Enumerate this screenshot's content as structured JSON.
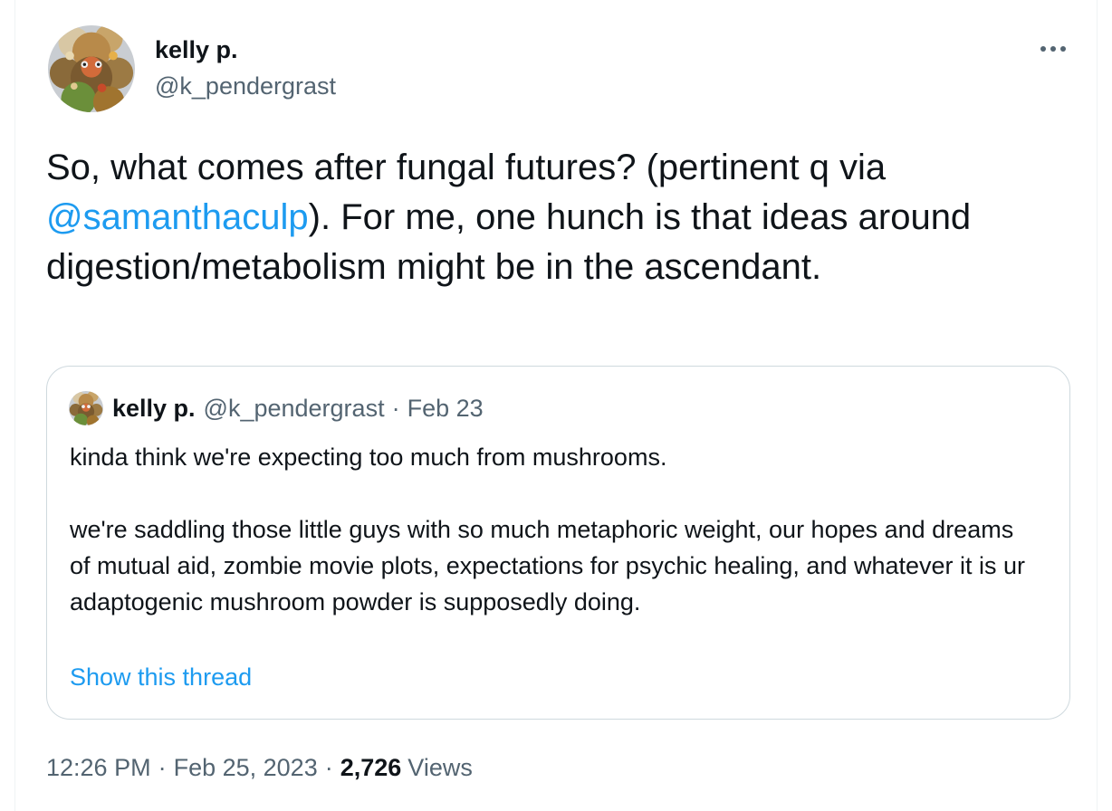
{
  "tweet": {
    "author": {
      "name": "kelly p.",
      "handle": "@k_pendergrast"
    },
    "more_icon": "more-horizontal-icon",
    "text": {
      "before_mention": "So, what comes after fungal futures? (pertinent q via ",
      "mention": "@samanthaculp",
      "after_mention": "). For me, one hunch is that ideas around digestion/metabolism might be in the ascendant."
    },
    "quoted": {
      "name": "kelly p.",
      "handle": "@k_pendergrast",
      "separator": "·",
      "date": "Feb 23",
      "paragraphs": [
        "kinda think we're expecting too much from mushrooms.",
        "we're saddling those little guys with so much metaphoric weight, our hopes and dreams of mutual aid, zombie movie plots, expectations for psychic healing, and whatever it is ur adaptogenic mushroom powder is supposedly doing."
      ],
      "show_thread": "Show this thread"
    },
    "meta": {
      "time": "12:26 PM",
      "separator": "·",
      "date": "Feb 25, 2023",
      "views_count": "2,726",
      "views_label": "Views"
    }
  },
  "colors": {
    "text_primary": "#0f1419",
    "text_secondary": "#536471",
    "link": "#1d9bf0",
    "border": "#cfd9de"
  }
}
